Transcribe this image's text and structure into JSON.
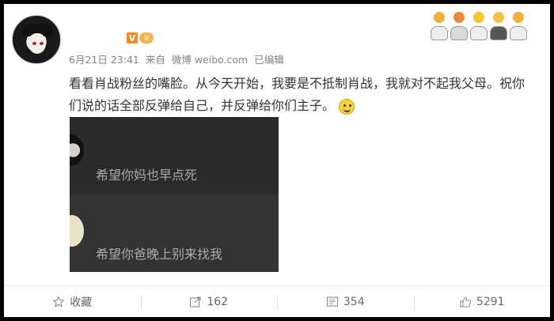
{
  "post": {
    "meta_date": "6月21日 23:41",
    "meta_from": "来自",
    "meta_source": "微博 weibo.com",
    "meta_edited": "已编辑",
    "text": "看看肖战粉丝的嘴脸。从今天开始，我要是不抵制肖战，我就对不起我父母。祝你们说的话全部反弹给自己，并反弹给你们主子。",
    "badge_v": "V"
  },
  "embedded_screenshot": {
    "message_1": "希望你妈也早点死",
    "message_2": "希望你爸晚上别来找我"
  },
  "actions": {
    "favorite": "收藏",
    "repost": "162",
    "comment": "354",
    "like": "5291"
  },
  "colors": {
    "accent_orange": "#f08a1c",
    "text": "#333333",
    "meta": "#808080"
  },
  "icons": [
    "star-icon",
    "share-icon",
    "comment-icon",
    "thumb-up-icon",
    "smile-emoji-icon"
  ]
}
